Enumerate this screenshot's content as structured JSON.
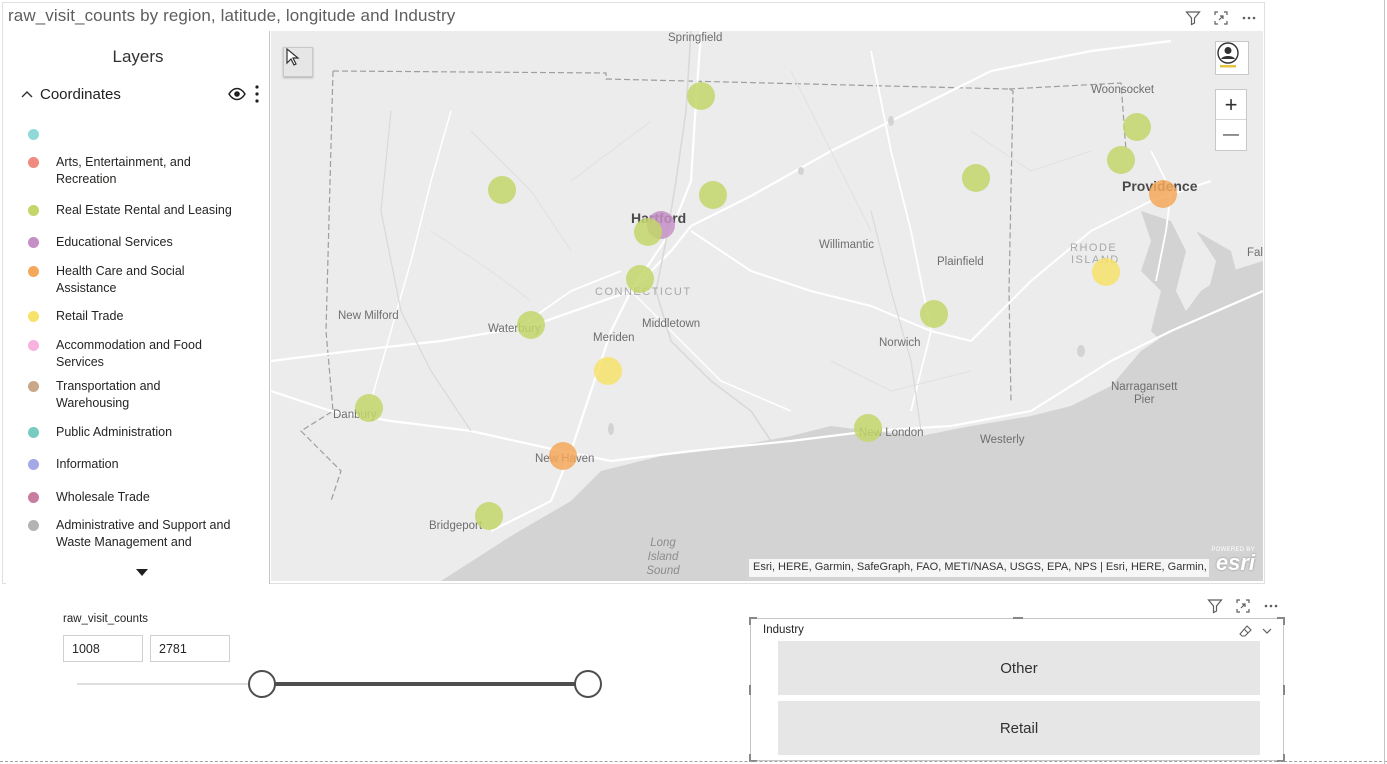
{
  "visual": {
    "title": "raw_visit_counts by region, latitude, longitude and Industry",
    "header_icons": [
      "filter-icon",
      "focus-mode-icon",
      "more-options-icon"
    ]
  },
  "layers_panel": {
    "title": "Layers",
    "group_label": "Coordinates",
    "legend": [
      {
        "label": "",
        "color": "#8fd9d9"
      },
      {
        "label": "Arts, Entertainment, and Recreation",
        "color": "#f08b80"
      },
      {
        "label": "Real Estate Rental and Leasing",
        "color": "#c3d66a"
      },
      {
        "label": "Educational Services",
        "color": "#c58fc6"
      },
      {
        "label": "Health Care and Social Assistance",
        "color": "#f5a85a"
      },
      {
        "label": "Retail Trade",
        "color": "#f7e26b"
      },
      {
        "label": "Accommodation and Food Services",
        "color": "#f6b3dd"
      },
      {
        "label": "Transportation and Warehousing",
        "color": "#c8a888"
      },
      {
        "label": "Public Administration",
        "color": "#78cbc1"
      },
      {
        "label": "Information",
        "color": "#a3a8e6"
      },
      {
        "label": "Wholesale Trade",
        "color": "#c87ca0"
      },
      {
        "label": "Administrative and Support and Waste Management and Remediation Services",
        "color": "#b3b3b3"
      }
    ]
  },
  "map": {
    "labels": {
      "springfield": "Springfield",
      "woonsocket": "Woonsocket",
      "providence": "Providence",
      "hartford": "Hartford",
      "willimantic": "Willimantic",
      "plainfield": "Plainfield",
      "rhode": "RHODE",
      "island": "ISLAND",
      "fall": "Fal",
      "connecticut": "CONNECTICUT",
      "new_milford": "New Milford",
      "waterbury": "Waterbury",
      "meriden": "Meriden",
      "middletown": "Middletown",
      "norwich": "Norwich",
      "narragansett": "Narragansett",
      "pier": "Pier",
      "danbury": "Danbury",
      "new_london": "New London",
      "westerly": "Westerly",
      "new_haven": "New Haven",
      "bridgeport": "Bridgeport",
      "long": "Long",
      "island_water": "Island",
      "sound": "Sound"
    },
    "attribution": "Esri, HERE, Garmin, SafeGraph, FAO, METI/NASA, USGS, EPA, NPS | Esri, HERE, Garmin, Safe...",
    "esri_powered": "POWERED BY",
    "esri_logo": "esri",
    "zoom_in": "+",
    "zoom_out": "—",
    "points": [
      {
        "city": "Springfield area",
        "industry": "Real Estate Rental and Leasing",
        "color": "#c3d66a"
      },
      {
        "city": "Woonsocket area",
        "industry": "Real Estate Rental and Leasing",
        "color": "#c3d66a"
      },
      {
        "city": "Providence north",
        "industry": "Real Estate Rental and Leasing",
        "color": "#c3d66a"
      },
      {
        "city": "Providence",
        "industry": "Health Care and Social Assistance",
        "color": "#f5a85a"
      },
      {
        "city": "Northeast CT",
        "industry": "Real Estate Rental and Leasing",
        "color": "#c3d66a"
      },
      {
        "city": "Northwest CT",
        "industry": "Real Estate Rental and Leasing",
        "color": "#c3d66a"
      },
      {
        "city": "East Hartford",
        "industry": "Real Estate Rental and Leasing",
        "color": "#c3d66a"
      },
      {
        "city": "Hartford",
        "industry": "Educational Services",
        "color": "#c58fc6"
      },
      {
        "city": "Hartford west",
        "industry": "Real Estate Rental and Leasing",
        "color": "#c3d66a"
      },
      {
        "city": "New Britain",
        "industry": "Real Estate Rental and Leasing",
        "color": "#c3d66a"
      },
      {
        "city": "Rhode Island",
        "industry": "Retail Trade",
        "color": "#f7e26b"
      },
      {
        "city": "Waterbury",
        "industry": "Real Estate Rental and Leasing",
        "color": "#c3d66a"
      },
      {
        "city": "Plainfield south",
        "industry": "Real Estate Rental and Leasing",
        "color": "#c3d66a"
      },
      {
        "city": "Meriden south",
        "industry": "Retail Trade",
        "color": "#f7e26b"
      },
      {
        "city": "Danbury",
        "industry": "Real Estate Rental and Leasing",
        "color": "#c3d66a"
      },
      {
        "city": "New London",
        "industry": "Real Estate Rental and Leasing",
        "color": "#c3d66a"
      },
      {
        "city": "New Haven",
        "industry": "Health Care and Social Assistance",
        "color": "#f5a85a"
      },
      {
        "city": "Bridgeport",
        "industry": "Real Estate Rental and Leasing",
        "color": "#c3d66a"
      }
    ]
  },
  "slider": {
    "title": "raw_visit_counts",
    "min_value": "1008",
    "max_value": "2781"
  },
  "industry_slicer": {
    "title": "Industry",
    "options": [
      "Other",
      "Retail"
    ]
  }
}
